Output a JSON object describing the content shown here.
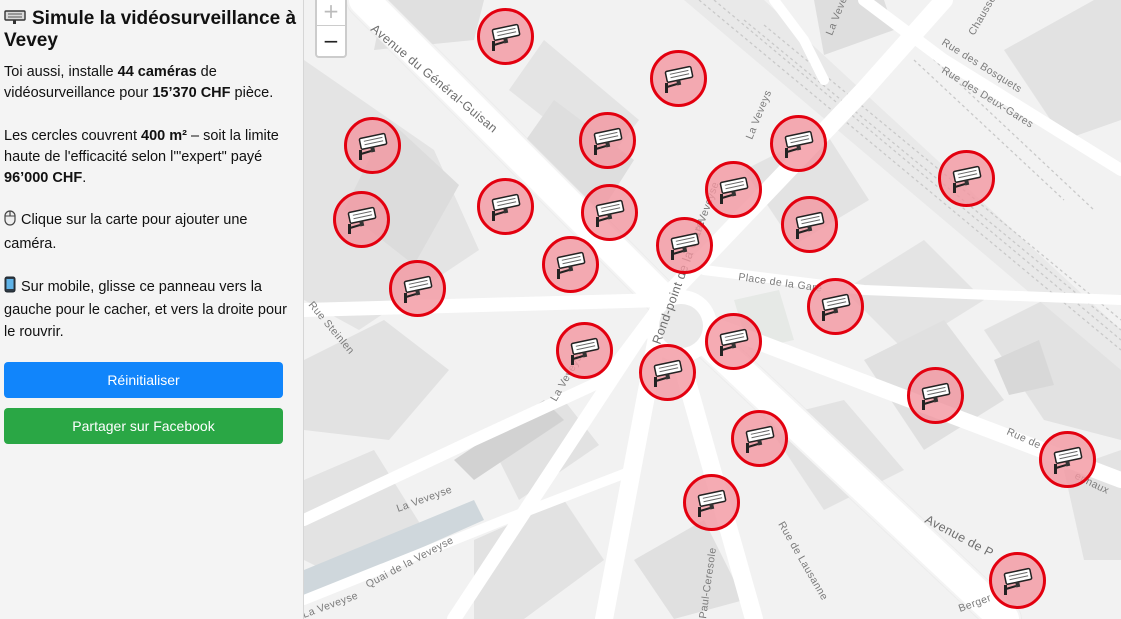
{
  "sidebar": {
    "title": "Simule la vidéosurveillance à Vevey",
    "intro": {
      "t1": "Toi aussi, installe ",
      "b1": "44 caméras",
      "t2": " de vidéosurveillance pour ",
      "b2": "15’370 CHF",
      "t3": " pièce."
    },
    "coverage": {
      "t1": "Les cercles couvrent ",
      "b1": "400 m²",
      "t2": " – soit la limite haute de l'efficacité selon l'\"expert\" payé ",
      "b2": "96’000 CHF",
      "t3": "."
    },
    "click_hint": "Clique sur la carte pour ajouter une caméra.",
    "mobile_hint": "Sur mobile, glisse ce panneau vers la gauche pour le cacher, et vers la droite pour le rouvrir.",
    "reset_label": "Réinitialiser",
    "share_label": "Partager sur Facebook"
  },
  "map": {
    "zoom_in": "+",
    "zoom_out": "−",
    "streets": {
      "general_guisan": "Avenue du Général-Guisan",
      "la_veveyse_top": "La Veveyse",
      "bosquets": "Rue des Bosquets",
      "deux_gares": "Rue des Deux-Gares",
      "chaussee": "Chaussée",
      "la_veveys": "La Veveys",
      "la_veveyse_mid": "La Veveyse",
      "place_gare": "Place de la Gare",
      "rond_point": "Rond-point de la Gare",
      "steinlen": "Rue Steinlen",
      "la_veveyse_left": "La Veveyse",
      "la_veveyse_low": "La Veveyse",
      "quai": "Quai de la Veveyse",
      "la_veveyse_bl": "La Veveyse",
      "paul_ceresole": "Paul-Ceresole",
      "lausanne": "Rue de Lausanne",
      "avenue_de": "Avenue de P",
      "rue_de": "Rue de",
      "simmonaux": "ennaux",
      "berger": "Berger"
    }
  },
  "colors": {
    "camera_ring": "#e3000f",
    "camera_fill": "#f396a0",
    "reset_button": "#1185fb",
    "share_button": "#2aa745"
  },
  "icons": {
    "title": "cctv-camera-icon",
    "click_hint": "mouse-icon",
    "mobile_hint": "mobile-phone-icon",
    "camera_marker": "cctv-camera-icon"
  }
}
